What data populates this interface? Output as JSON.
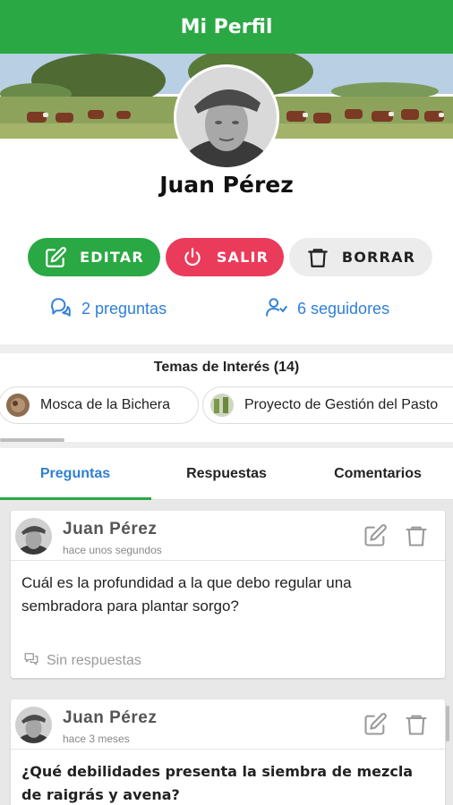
{
  "appbar": {
    "title": "Mi Perfil"
  },
  "profile": {
    "name": "Juan Pérez"
  },
  "actions": {
    "edit_label": "EDITAR",
    "exit_label": "SALIR",
    "delete_label": "BORRAR"
  },
  "stats": {
    "questions": "2 preguntas",
    "followers": "6 seguidores"
  },
  "topics": {
    "title": "Temas de Interés (14)",
    "chips": [
      {
        "label": "Mosca de la Bichera"
      },
      {
        "label": "Proyecto de Gestión del Pasto"
      }
    ]
  },
  "tabs": [
    {
      "label": "Preguntas",
      "active": true
    },
    {
      "label": "Respuestas",
      "active": false
    },
    {
      "label": "Comentarios",
      "active": false
    }
  ],
  "posts": [
    {
      "author": "Juan Pérez",
      "time": "hace unos segundos",
      "text": "Cuál es la profundidad a la que debo regular una sembradora para plantar sorgo?",
      "footer": "Sin respuestas"
    },
    {
      "author": "Juan Pérez",
      "time": "hace 3 meses",
      "text": "¿Qué debilidades presenta la siembra de mezcla de raigrás y avena?"
    }
  ],
  "colors": {
    "primary_green": "#2aa844",
    "exit_red": "#eb3b5a",
    "link_blue": "#2f7fd6"
  },
  "icons": [
    "edit-icon",
    "power-icon",
    "trash-icon",
    "questions-icon",
    "followers-icon",
    "reply-icon"
  ]
}
